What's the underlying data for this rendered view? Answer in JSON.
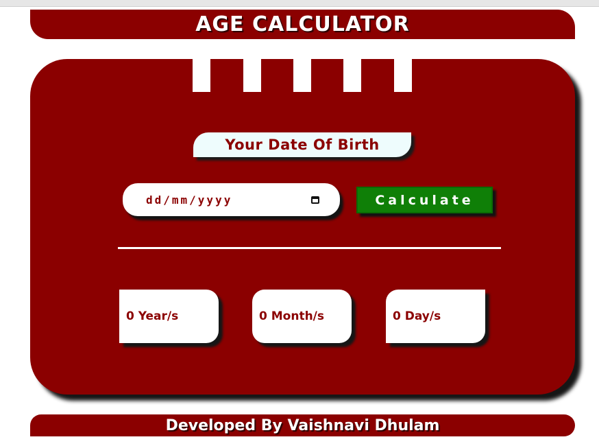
{
  "header": {
    "title": "AGE CALCULATOR"
  },
  "form": {
    "label": "Your Date Of Birth",
    "date_placeholder": "dd/mm/yyyy",
    "calendar_icon": "calendar-icon",
    "calculate_label": "Calculate"
  },
  "results": [
    {
      "label": "0 Year/s"
    },
    {
      "label": "0 Month/s"
    },
    {
      "label": "0 Day/s"
    }
  ],
  "footer": {
    "text": "Developed By Vaishnavi Dhulam"
  },
  "colors": {
    "primary": "#8b0000",
    "button": "#0f7f07",
    "label_bg": "#eefcfd",
    "surface": "#ffffff"
  }
}
